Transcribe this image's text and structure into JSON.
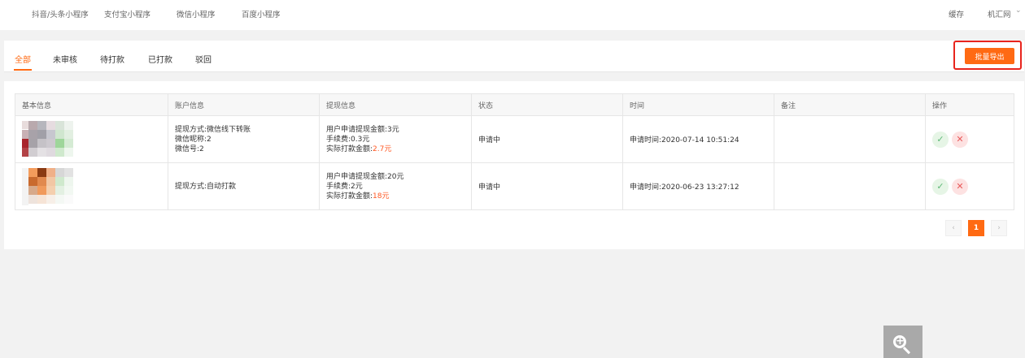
{
  "topnav": {
    "items": [
      "抖音/头条小程序",
      "支付宝小程序",
      "微信小程序",
      "百度小程序"
    ],
    "cache": "缓存",
    "site": "机汇网"
  },
  "tabs": [
    "全部",
    "未审核",
    "待打款",
    "已打款",
    "驳回"
  ],
  "active_tab": "全部",
  "toolbar": {
    "export_label": "批量导出",
    "highlight_color": "#e8241d"
  },
  "table": {
    "headers": [
      "基本信息",
      "账户信息",
      "提现信息",
      "状态",
      "时间",
      "备注",
      "操作"
    ],
    "rows": [
      {
        "account": [
          "提现方式:微信线下转账",
          "微信昵称:2",
          "微信号:2"
        ],
        "apply_prefix": "用户申请提现金额:",
        "apply_amount": "3元",
        "fee_prefix": "手续费:",
        "fee": "0.3元",
        "paid_prefix": "实际打款金额:",
        "paid": "2.7元",
        "status": "申请中",
        "time": "申请时间:2020-07-14 10:51:24",
        "remark": ""
      },
      {
        "account": [
          "提现方式:自动打款"
        ],
        "apply_prefix": "用户申请提现金额:",
        "apply_amount": "20元",
        "fee_prefix": "手续费:",
        "fee": "2元",
        "paid_prefix": "实际打款金额:",
        "paid": "18元",
        "status": "申请中",
        "time": "申请时间:2020-06-23 13:27:12",
        "remark": ""
      }
    ]
  },
  "pagination": {
    "prev": "‹",
    "current": "1",
    "next": "›"
  },
  "icons": {
    "approve": "check-icon",
    "reject": "close-icon",
    "zoom": "zoom-in-icon",
    "dropdown": "chevron-down-icon"
  },
  "colors": {
    "accent": "#ff6a13",
    "approve": "#5fb878",
    "reject": "#e85a5a",
    "amount": "#ff5722"
  }
}
